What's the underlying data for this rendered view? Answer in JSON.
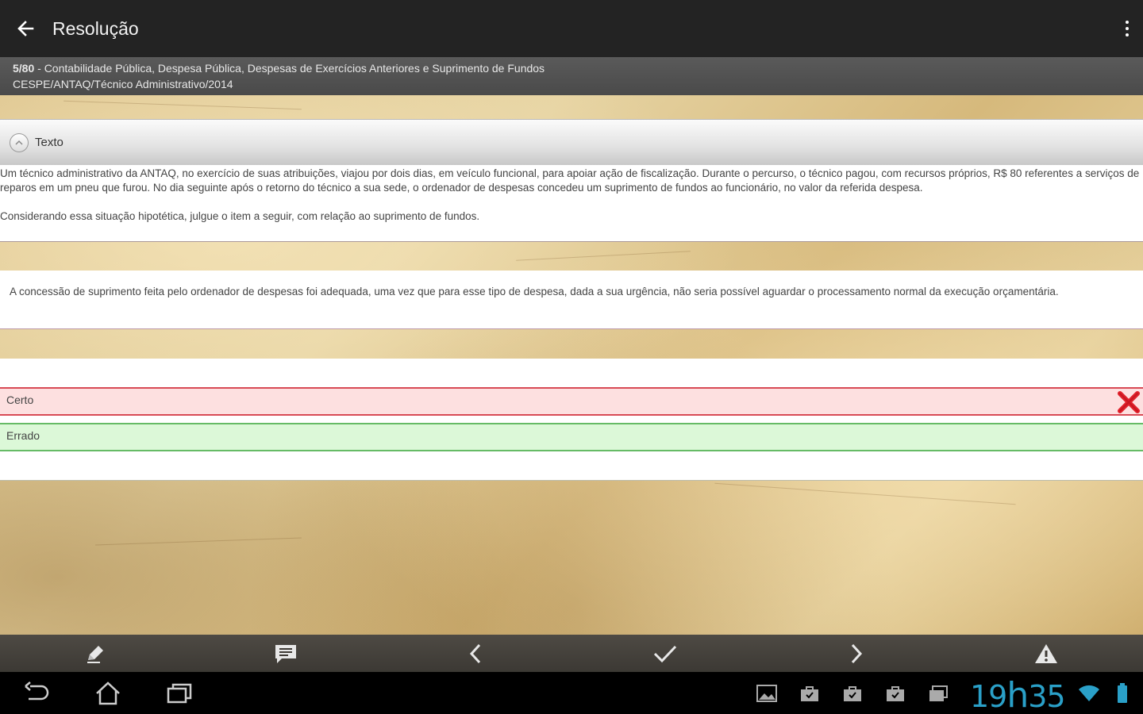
{
  "actionbar": {
    "title": "Resolução"
  },
  "subheader": {
    "question_number": "5/80",
    "subject": " - Contabilidade Pública, Despesa Pública, Despesas de Exercícios Anteriores e Suprimento de Fundos",
    "source": "CESPE/ANTAQ/Técnico Administrativo/2014"
  },
  "texto": {
    "label": "Texto",
    "paragraph1": "Um técnico administrativo da ANTAQ, no exercício de suas atribuições, viajou por dois dias, em veículo funcional, para apoiar ação de fiscalização. Durante o percurso, o técnico pagou, com recursos próprios, R$ 80 referentes a serviços de reparos em um pneu que furou. No dia seguinte após o retorno do técnico a sua sede, o ordenador de despesas concedeu um suprimento de fundos ao funcionário, no valor da referida despesa.",
    "paragraph2": "Considerando essa situação hipotética, julgue o item a seguir, com relação ao suprimento de fundos."
  },
  "statement": {
    "text": "A concessão de suprimento feita pelo ordenador de despesas foi adequada, uma vez que para esse tipo de despesa, dada a sua urgência, não seria possível aguardar o processamento normal da execução orçamentária."
  },
  "options": [
    {
      "label": "Certo",
      "state": "wrong"
    },
    {
      "label": "Errado",
      "state": "correct"
    }
  ],
  "colors": {
    "wrong_bg": "#fde0e0",
    "wrong_border": "#d84a55",
    "correct_bg": "#dcf8d8",
    "correct_border": "#66bb66",
    "clock": "#2aa0c8"
  },
  "toolbar_icons": [
    "pencil-icon",
    "comment-icon",
    "chevron-left-icon",
    "check-icon",
    "chevron-right-icon",
    "warning-icon"
  ],
  "statusbar": {
    "clock_hours": "19",
    "clock_sep": "h",
    "clock_minutes": "35"
  }
}
